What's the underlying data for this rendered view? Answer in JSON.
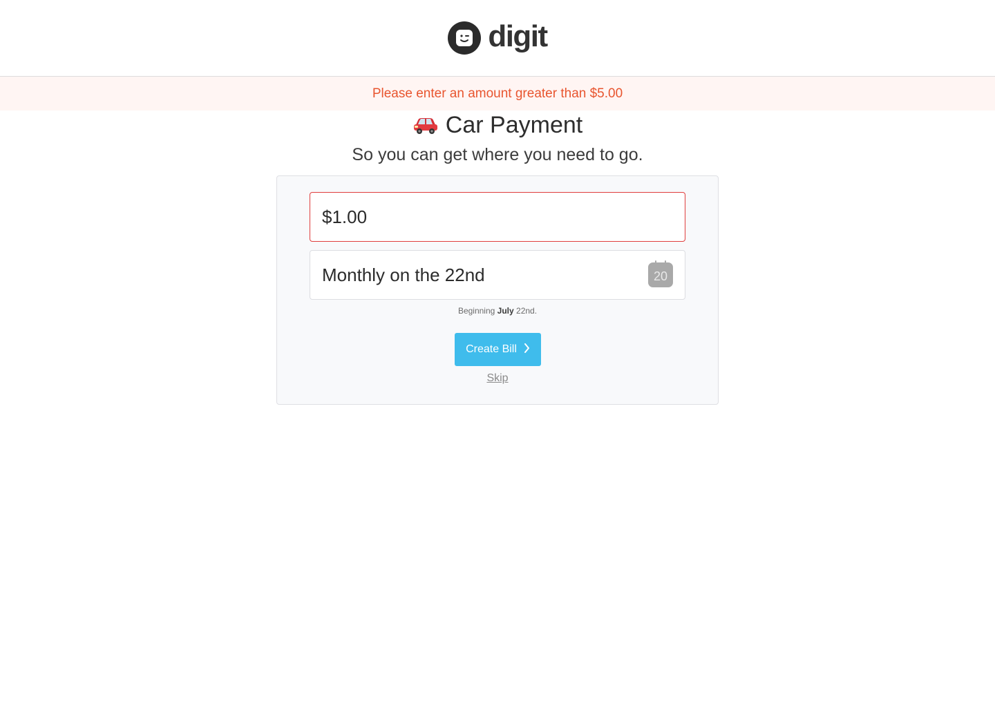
{
  "header": {
    "logo_text": "digit"
  },
  "alert": {
    "message": "Please enter an amount greater than $5.00",
    "color": "#e8552f"
  },
  "bill": {
    "title": "Car Payment",
    "title_icon": "car-icon",
    "subtitle": "So you can get where you need to go."
  },
  "form": {
    "amount_value": "$1.00",
    "schedule_value": "Monthly on the 22nd",
    "calendar_icon_label": "20",
    "beginning_prefix": "Beginning",
    "beginning_month": "July",
    "beginning_suffix": "22nd.",
    "create_button_label": "Create Bill",
    "skip_label": "Skip"
  },
  "colors": {
    "accent": "#3fbcec",
    "error_border": "#e03c3c",
    "alert_bg": "#fff5f3"
  }
}
